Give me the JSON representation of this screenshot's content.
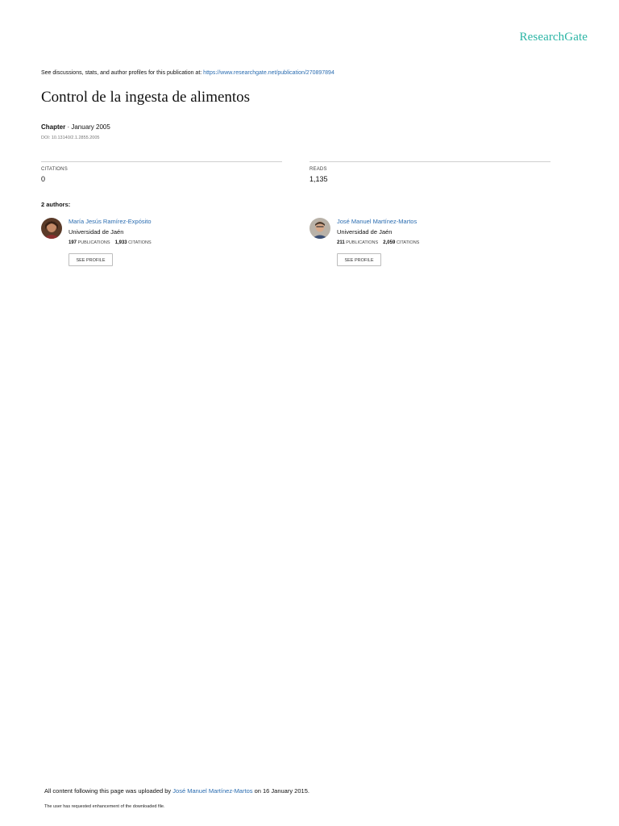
{
  "brand": "ResearchGate",
  "discussion": {
    "prefix": "See discussions, stats, and author profiles for this publication at: ",
    "url": "https://www.researchgate.net/publication/270897894"
  },
  "title": "Control de la ingesta de alimentos",
  "meta": {
    "kind": "Chapter",
    "date": " · January 2005"
  },
  "doi": "DOI: 10.13140/2.1.2855.2005",
  "stats": {
    "citations_label": "CITATIONS",
    "citations_value": "0",
    "reads_label": "READS",
    "reads_value": "1,135"
  },
  "authors_heading": "2 authors:",
  "authors": [
    {
      "name": "María Jesús Ramírez-Expósito",
      "institution": "Universidad de Jaén",
      "publications": "197",
      "publications_label": "PUBLICATIONS",
      "citations": "1,933",
      "citations_label": "CITATIONS",
      "button": "SEE PROFILE"
    },
    {
      "name": "José Manuel Martínez-Martos",
      "institution": "Universidad de Jaén",
      "publications": "211",
      "publications_label": "PUBLICATIONS",
      "citations": "2,059",
      "citations_label": "CITATIONS",
      "button": "SEE PROFILE"
    }
  ],
  "footer": {
    "uploaded_prefix": "All content following this page was uploaded by ",
    "uploader": "José Manuel Martínez-Martos",
    "uploaded_suffix": " on 16 January 2015.",
    "enhancement": "The user has requested enhancement of the downloaded file."
  },
  "colors": {
    "brand": "#2bb5a5",
    "link": "#2a6cb0"
  }
}
